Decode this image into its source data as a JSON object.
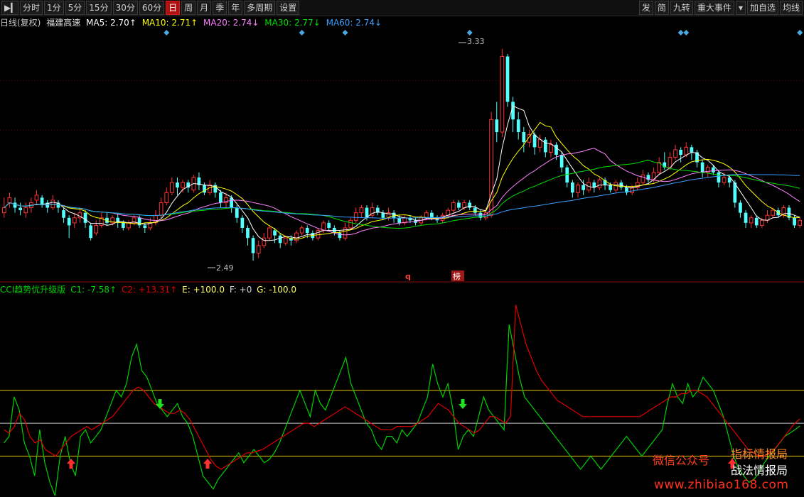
{
  "toolbar": {
    "periods": [
      "分时",
      "1分",
      "5分",
      "15分",
      "30分",
      "60分",
      "日",
      "周",
      "月",
      "季",
      "年",
      "多周期",
      "设置"
    ],
    "active": "日",
    "right": [
      "发",
      "简",
      "九转",
      "重大事件",
      "▾",
      "加自选",
      "均线"
    ]
  },
  "header": {
    "chart_type": "日线(复权)",
    "stock_name": "福建高速",
    "ma5": "MA5: 2.70↑",
    "ma10": "MA10: 2.71↑",
    "ma20": "MA20: 2.74↓",
    "ma30": "MA30: 2.77↓",
    "ma60": "MA60: 2.74↓"
  },
  "colors": {
    "up": "#ff3232",
    "down": "#54ffff",
    "ma5": "#ffffff",
    "ma10": "#ffff00",
    "ma20": "#ff80ff",
    "ma30": "#00e000",
    "ma60": "#3aa0ff",
    "cci_c1": "#00d000",
    "cci_c2": "#e00000"
  },
  "annotations": {
    "high": "3.33",
    "low": "2.49",
    "badge_q": "q",
    "badge_bang": "榜"
  },
  "indicator": {
    "name": "CCI趋势优升级版",
    "c1": "C1: -7.58↑",
    "c2": "C2: +13.31↑",
    "e": "E: +100.0",
    "f": "F: +0",
    "g": "G: -100.0"
  },
  "watermark": {
    "line1": "微信公众号",
    "line2": "指标情报局",
    "line3": "战法情报局",
    "url": "www.zhibiao168.com"
  },
  "chart_data": [
    {
      "type": "candlestick",
      "price_range": [
        2.42,
        3.4
      ],
      "high_label": 3.33,
      "low_label": 2.49,
      "candles": [
        [
          2.68,
          2.7,
          2.74,
          2.66
        ],
        [
          2.72,
          2.74,
          2.76,
          2.7
        ],
        [
          2.72,
          2.7,
          2.74,
          2.68
        ],
        [
          2.7,
          2.69,
          2.72,
          2.67
        ],
        [
          2.68,
          2.7,
          2.72,
          2.66
        ],
        [
          2.7,
          2.72,
          2.74,
          2.68
        ],
        [
          2.73,
          2.75,
          2.77,
          2.71
        ],
        [
          2.74,
          2.71,
          2.75,
          2.7
        ],
        [
          2.72,
          2.7,
          2.73,
          2.68
        ],
        [
          2.7,
          2.73,
          2.75,
          2.69
        ],
        [
          2.72,
          2.7,
          2.73,
          2.68
        ],
        [
          2.69,
          2.66,
          2.7,
          2.64
        ],
        [
          2.66,
          2.63,
          2.67,
          2.58
        ],
        [
          2.64,
          2.66,
          2.68,
          2.62
        ],
        [
          2.66,
          2.68,
          2.7,
          2.64
        ],
        [
          2.68,
          2.64,
          2.69,
          2.62
        ],
        [
          2.63,
          2.58,
          2.64,
          2.57
        ],
        [
          2.6,
          2.63,
          2.65,
          2.59
        ],
        [
          2.63,
          2.66,
          2.68,
          2.62
        ],
        [
          2.66,
          2.64,
          2.68,
          2.63
        ],
        [
          2.64,
          2.66,
          2.67,
          2.63
        ],
        [
          2.66,
          2.64,
          2.68,
          2.62
        ],
        [
          2.64,
          2.62,
          2.65,
          2.61
        ],
        [
          2.62,
          2.64,
          2.65,
          2.61
        ],
        [
          2.64,
          2.66,
          2.67,
          2.63
        ],
        [
          2.66,
          2.63,
          2.67,
          2.62
        ],
        [
          2.63,
          2.62,
          2.64,
          2.6
        ],
        [
          2.62,
          2.64,
          2.66,
          2.61
        ],
        [
          2.64,
          2.67,
          2.69,
          2.63
        ],
        [
          2.67,
          2.72,
          2.74,
          2.66
        ],
        [
          2.72,
          2.76,
          2.78,
          2.71
        ],
        [
          2.76,
          2.8,
          2.82,
          2.75
        ],
        [
          2.8,
          2.78,
          2.82,
          2.75
        ],
        [
          2.78,
          2.8,
          2.81,
          2.76
        ],
        [
          2.8,
          2.78,
          2.81,
          2.76
        ],
        [
          2.77,
          2.82,
          2.83,
          2.76
        ],
        [
          2.82,
          2.79,
          2.84,
          2.77
        ],
        [
          2.79,
          2.76,
          2.8,
          2.75
        ],
        [
          2.76,
          2.79,
          2.81,
          2.75
        ],
        [
          2.79,
          2.76,
          2.8,
          2.74
        ],
        [
          2.76,
          2.72,
          2.77,
          2.7
        ],
        [
          2.72,
          2.74,
          2.76,
          2.7
        ],
        [
          2.74,
          2.7,
          2.75,
          2.68
        ],
        [
          2.7,
          2.66,
          2.71,
          2.64
        ],
        [
          2.66,
          2.62,
          2.67,
          2.6
        ],
        [
          2.62,
          2.58,
          2.63,
          2.55
        ],
        [
          2.58,
          2.52,
          2.59,
          2.49
        ],
        [
          2.52,
          2.55,
          2.57,
          2.5
        ],
        [
          2.55,
          2.58,
          2.6,
          2.54
        ],
        [
          2.58,
          2.62,
          2.63,
          2.57
        ],
        [
          2.61,
          2.59,
          2.62,
          2.56
        ],
        [
          2.59,
          2.56,
          2.6,
          2.54
        ],
        [
          2.56,
          2.58,
          2.59,
          2.55
        ],
        [
          2.58,
          2.57,
          2.59,
          2.55
        ],
        [
          2.57,
          2.6,
          2.61,
          2.56
        ],
        [
          2.6,
          2.62,
          2.63,
          2.59
        ],
        [
          2.62,
          2.6,
          2.63,
          2.58
        ],
        [
          2.6,
          2.58,
          2.61,
          2.57
        ],
        [
          2.58,
          2.61,
          2.62,
          2.57
        ],
        [
          2.61,
          2.64,
          2.65,
          2.6
        ],
        [
          2.64,
          2.62,
          2.65,
          2.61
        ],
        [
          2.62,
          2.6,
          2.63,
          2.59
        ],
        [
          2.6,
          2.58,
          2.61,
          2.57
        ],
        [
          2.58,
          2.62,
          2.64,
          2.57
        ],
        [
          2.62,
          2.65,
          2.66,
          2.61
        ],
        [
          2.65,
          2.68,
          2.7,
          2.64
        ],
        [
          2.68,
          2.7,
          2.71,
          2.66
        ],
        [
          2.7,
          2.66,
          2.71,
          2.65
        ],
        [
          2.67,
          2.7,
          2.72,
          2.66
        ],
        [
          2.7,
          2.68,
          2.71,
          2.67
        ],
        [
          2.68,
          2.66,
          2.69,
          2.65
        ],
        [
          2.66,
          2.68,
          2.7,
          2.65
        ],
        [
          2.68,
          2.66,
          2.69,
          2.64
        ],
        [
          2.66,
          2.64,
          2.67,
          2.63
        ],
        [
          2.64,
          2.66,
          2.67,
          2.63
        ],
        [
          2.66,
          2.65,
          2.67,
          2.64
        ],
        [
          2.65,
          2.64,
          2.66,
          2.63
        ],
        [
          2.64,
          2.66,
          2.67,
          2.63
        ],
        [
          2.66,
          2.68,
          2.69,
          2.65
        ],
        [
          2.68,
          2.66,
          2.69,
          2.65
        ],
        [
          2.66,
          2.65,
          2.67,
          2.64
        ],
        [
          2.65,
          2.67,
          2.68,
          2.64
        ],
        [
          2.67,
          2.69,
          2.7,
          2.66
        ],
        [
          2.69,
          2.72,
          2.73,
          2.68
        ],
        [
          2.72,
          2.7,
          2.73,
          2.69
        ],
        [
          2.7,
          2.72,
          2.73,
          2.69
        ],
        [
          2.72,
          2.7,
          2.73,
          2.69
        ],
        [
          2.7,
          2.68,
          2.71,
          2.67
        ],
        [
          2.68,
          2.66,
          2.69,
          2.65
        ],
        [
          2.66,
          2.68,
          2.7,
          2.65
        ],
        [
          2.67,
          3.05,
          3.08,
          2.66
        ],
        [
          3.05,
          3.0,
          3.12,
          2.96
        ],
        [
          3.0,
          3.3,
          3.33,
          2.98
        ],
        [
          3.3,
          3.12,
          3.31,
          3.1
        ],
        [
          3.12,
          3.05,
          3.14,
          3.0
        ],
        [
          3.05,
          3.0,
          3.08,
          2.97
        ],
        [
          3.0,
          2.96,
          3.02,
          2.92
        ],
        [
          2.96,
          2.99,
          3.01,
          2.94
        ],
        [
          2.99,
          2.94,
          3.0,
          2.91
        ],
        [
          2.94,
          2.97,
          2.99,
          2.92
        ],
        [
          2.97,
          2.92,
          2.98,
          2.9
        ],
        [
          2.92,
          2.95,
          2.97,
          2.9
        ],
        [
          2.95,
          2.91,
          2.96,
          2.89
        ],
        [
          2.91,
          2.86,
          2.92,
          2.84
        ],
        [
          2.86,
          2.8,
          2.87,
          2.78
        ],
        [
          2.8,
          2.76,
          2.81,
          2.74
        ],
        [
          2.76,
          2.79,
          2.8,
          2.74
        ],
        [
          2.79,
          2.77,
          2.81,
          2.75
        ],
        [
          2.77,
          2.8,
          2.82,
          2.76
        ],
        [
          2.8,
          2.78,
          2.81,
          2.76
        ],
        [
          2.78,
          2.81,
          2.82,
          2.77
        ],
        [
          2.81,
          2.79,
          2.82,
          2.77
        ],
        [
          2.79,
          2.77,
          2.8,
          2.76
        ],
        [
          2.77,
          2.8,
          2.81,
          2.76
        ],
        [
          2.8,
          2.78,
          2.81,
          2.77
        ],
        [
          2.78,
          2.76,
          2.79,
          2.75
        ],
        [
          2.76,
          2.78,
          2.79,
          2.75
        ],
        [
          2.78,
          2.8,
          2.82,
          2.77
        ],
        [
          2.8,
          2.83,
          2.85,
          2.79
        ],
        [
          2.83,
          2.81,
          2.84,
          2.8
        ],
        [
          2.81,
          2.84,
          2.86,
          2.8
        ],
        [
          2.84,
          2.88,
          2.9,
          2.83
        ],
        [
          2.88,
          2.86,
          2.92,
          2.85
        ],
        [
          2.86,
          2.9,
          2.92,
          2.85
        ],
        [
          2.9,
          2.93,
          2.95,
          2.89
        ],
        [
          2.93,
          2.91,
          2.94,
          2.88
        ],
        [
          2.91,
          2.94,
          2.96,
          2.9
        ],
        [
          2.94,
          2.92,
          2.95,
          2.89
        ],
        [
          2.92,
          2.88,
          2.93,
          2.86
        ],
        [
          2.88,
          2.84,
          2.89,
          2.82
        ],
        [
          2.84,
          2.86,
          2.87,
          2.82
        ],
        [
          2.86,
          2.84,
          2.87,
          2.83
        ],
        [
          2.84,
          2.8,
          2.85,
          2.78
        ],
        [
          2.8,
          2.82,
          2.84,
          2.79
        ],
        [
          2.82,
          2.8,
          2.83,
          2.78
        ],
        [
          2.8,
          2.72,
          2.81,
          2.7
        ],
        [
          2.72,
          2.68,
          2.73,
          2.66
        ],
        [
          2.68,
          2.64,
          2.69,
          2.62
        ],
        [
          2.64,
          2.66,
          2.67,
          2.62
        ],
        [
          2.66,
          2.63,
          2.67,
          2.62
        ],
        [
          2.63,
          2.65,
          2.66,
          2.62
        ],
        [
          2.65,
          2.67,
          2.69,
          2.64
        ],
        [
          2.67,
          2.69,
          2.7,
          2.66
        ],
        [
          2.69,
          2.67,
          2.7,
          2.66
        ],
        [
          2.67,
          2.7,
          2.71,
          2.66
        ],
        [
          2.7,
          2.66,
          2.71,
          2.65
        ],
        [
          2.66,
          2.63,
          2.67,
          2.62
        ],
        [
          2.63,
          2.65,
          2.66,
          2.62
        ]
      ],
      "ma_periods": [
        5,
        10,
        20,
        30,
        60
      ]
    },
    {
      "type": "line",
      "range": [
        -220,
        380
      ],
      "levels": [
        100,
        0,
        -100
      ],
      "series": [
        {
          "name": "C1",
          "values": [
            -60,
            -40,
            80,
            40,
            -60,
            -100,
            -160,
            -20,
            -120,
            -180,
            -220,
            -100,
            -40,
            -120,
            -160,
            -40,
            -20,
            -60,
            -40,
            -20,
            20,
            60,
            100,
            80,
            120,
            200,
            240,
            160,
            140,
            100,
            60,
            40,
            20,
            40,
            60,
            20,
            0,
            -40,
            -100,
            -160,
            -180,
            -200,
            -170,
            -150,
            -130,
            -110,
            -90,
            -120,
            -100,
            -80,
            -100,
            -120,
            -110,
            -90,
            -60,
            -20,
            20,
            60,
            100,
            60,
            20,
            100,
            60,
            40,
            80,
            120,
            160,
            200,
            120,
            80,
            40,
            0,
            -20,
            -60,
            -80,
            -40,
            -40,
            -60,
            -20,
            -40,
            -20,
            0,
            40,
            80,
            180,
            120,
            80,
            120,
            40,
            -80,
            -40,
            -20,
            -40,
            20,
            80,
            40,
            20,
            0,
            -20,
            300,
            220,
            140,
            80,
            60,
            40,
            20,
            0,
            -20,
            -40,
            -60,
            -80,
            -100,
            -120,
            -140,
            -120,
            -100,
            -120,
            -140,
            -120,
            -100,
            -80,
            -60,
            -40,
            -60,
            -80,
            -100,
            -80,
            -60,
            -40,
            -20,
            60,
            120,
            80,
            60,
            120,
            80,
            100,
            140,
            120,
            100,
            60,
            20,
            -40,
            -100,
            -140,
            -160,
            -180,
            -170,
            -150,
            -120,
            -100,
            -80,
            -60,
            -40,
            -30,
            -20,
            -8
          ]
        },
        {
          "name": "C2",
          "values": [
            -20,
            -30,
            -10,
            30,
            10,
            -40,
            -60,
            -50,
            -80,
            -90,
            -100,
            -80,
            -60,
            -40,
            -30,
            -20,
            -10,
            -20,
            -10,
            0,
            10,
            20,
            40,
            60,
            80,
            100,
            110,
            100,
            80,
            60,
            50,
            40,
            30,
            30,
            40,
            30,
            10,
            -20,
            -50,
            -80,
            -110,
            -130,
            -140,
            -130,
            -120,
            -110,
            -100,
            -90,
            -90,
            -85,
            -80,
            -70,
            -60,
            -50,
            -40,
            -30,
            -20,
            -10,
            0,
            0,
            -10,
            0,
            10,
            20,
            30,
            40,
            50,
            40,
            30,
            20,
            10,
            0,
            -10,
            -20,
            -20,
            -20,
            -10,
            -10,
            -10,
            -10,
            0,
            10,
            20,
            40,
            60,
            50,
            40,
            20,
            0,
            -10,
            -20,
            -30,
            -20,
            0,
            20,
            20,
            10,
            0,
            20,
            360,
            300,
            240,
            200,
            160,
            130,
            110,
            90,
            70,
            60,
            50,
            40,
            30,
            20,
            20,
            20,
            20,
            20,
            20,
            20,
            20,
            20,
            20,
            20,
            20,
            30,
            40,
            50,
            60,
            70,
            80,
            80,
            90,
            90,
            100,
            100,
            90,
            80,
            60,
            40,
            20,
            0,
            -20,
            -40,
            -60,
            -80,
            -90,
            -100,
            -100,
            -90,
            -80,
            -60,
            -40,
            -20,
            0,
            13
          ]
        }
      ]
    }
  ]
}
